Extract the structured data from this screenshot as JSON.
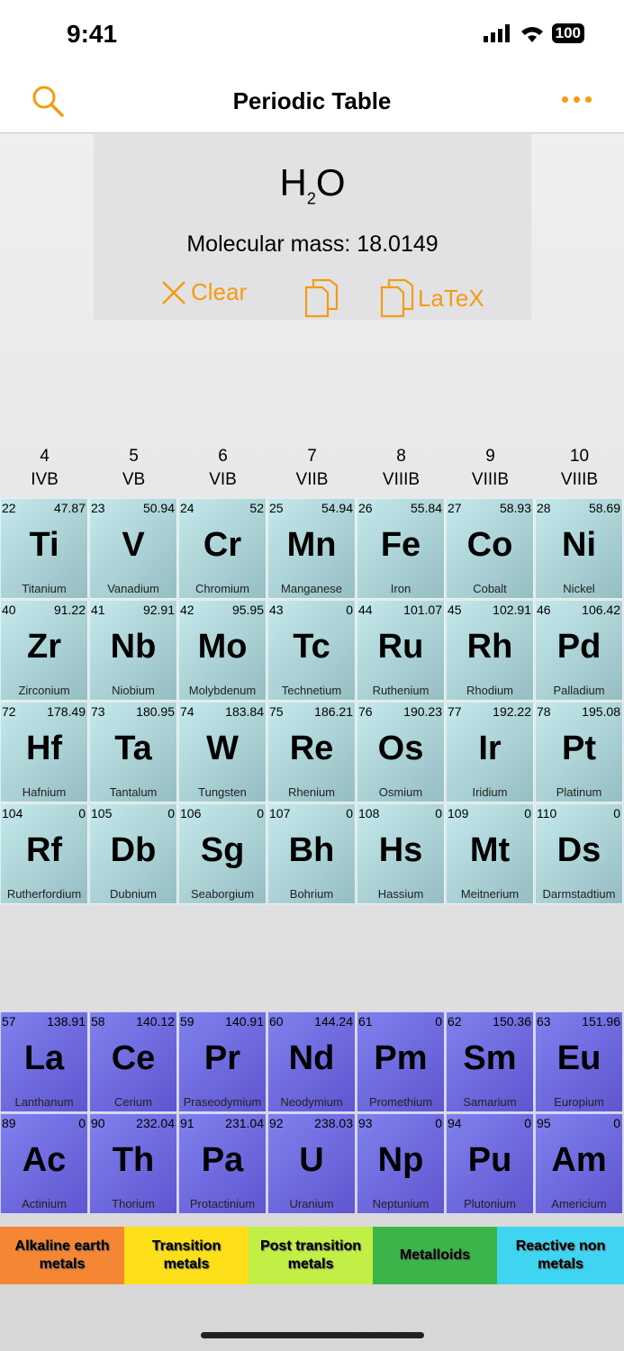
{
  "status": {
    "time": "9:41",
    "battery": "100"
  },
  "nav": {
    "title": "Periodic Table"
  },
  "formula": {
    "main": "H",
    "sub": "2",
    "tail": "O",
    "mass": "Molecular mass: 18.0149",
    "clear": "Clear",
    "latex": "LaTeX"
  },
  "groups": [
    {
      "n": "4",
      "r": "IVB"
    },
    {
      "n": "5",
      "r": "VB"
    },
    {
      "n": "6",
      "r": "VIB"
    },
    {
      "n": "7",
      "r": "VIIB"
    },
    {
      "n": "8",
      "r": "VIIIB"
    },
    {
      "n": "9",
      "r": "VIIIB"
    },
    {
      "n": "10",
      "r": "VIIIB"
    }
  ],
  "transition": [
    [
      {
        "n": "22",
        "m": "47.87",
        "s": "Ti",
        "name": "Titanium"
      },
      {
        "n": "23",
        "m": "50.94",
        "s": "V",
        "name": "Vanadium"
      },
      {
        "n": "24",
        "m": "52",
        "s": "Cr",
        "name": "Chromium"
      },
      {
        "n": "25",
        "m": "54.94",
        "s": "Mn",
        "name": "Manganese"
      },
      {
        "n": "26",
        "m": "55.84",
        "s": "Fe",
        "name": "Iron"
      },
      {
        "n": "27",
        "m": "58.93",
        "s": "Co",
        "name": "Cobalt"
      },
      {
        "n": "28",
        "m": "58.69",
        "s": "Ni",
        "name": "Nickel"
      }
    ],
    [
      {
        "n": "40",
        "m": "91.22",
        "s": "Zr",
        "name": "Zirconium"
      },
      {
        "n": "41",
        "m": "92.91",
        "s": "Nb",
        "name": "Niobium"
      },
      {
        "n": "42",
        "m": "95.95",
        "s": "Mo",
        "name": "Molybdenum"
      },
      {
        "n": "43",
        "m": "0",
        "s": "Tc",
        "name": "Technetium"
      },
      {
        "n": "44",
        "m": "101.07",
        "s": "Ru",
        "name": "Ruthenium"
      },
      {
        "n": "45",
        "m": "102.91",
        "s": "Rh",
        "name": "Rhodium"
      },
      {
        "n": "46",
        "m": "106.42",
        "s": "Pd",
        "name": "Palladium"
      }
    ],
    [
      {
        "n": "72",
        "m": "178.49",
        "s": "Hf",
        "name": "Hafnium"
      },
      {
        "n": "73",
        "m": "180.95",
        "s": "Ta",
        "name": "Tantalum"
      },
      {
        "n": "74",
        "m": "183.84",
        "s": "W",
        "name": "Tungsten"
      },
      {
        "n": "75",
        "m": "186.21",
        "s": "Re",
        "name": "Rhenium"
      },
      {
        "n": "76",
        "m": "190.23",
        "s": "Os",
        "name": "Osmium"
      },
      {
        "n": "77",
        "m": "192.22",
        "s": "Ir",
        "name": "Iridium"
      },
      {
        "n": "78",
        "m": "195.08",
        "s": "Pt",
        "name": "Platinum"
      }
    ],
    [
      {
        "n": "104",
        "m": "0",
        "s": "Rf",
        "name": "Rutherfordium"
      },
      {
        "n": "105",
        "m": "0",
        "s": "Db",
        "name": "Dubnium"
      },
      {
        "n": "106",
        "m": "0",
        "s": "Sg",
        "name": "Seaborgium"
      },
      {
        "n": "107",
        "m": "0",
        "s": "Bh",
        "name": "Bohrium"
      },
      {
        "n": "108",
        "m": "0",
        "s": "Hs",
        "name": "Hassium"
      },
      {
        "n": "109",
        "m": "0",
        "s": "Mt",
        "name": "Meitnerium"
      },
      {
        "n": "110",
        "m": "0",
        "s": "Ds",
        "name": "Darmstadtium"
      }
    ]
  ],
  "fblock": [
    [
      {
        "n": "57",
        "m": "138.91",
        "s": "La",
        "name": "Lanthanum"
      },
      {
        "n": "58",
        "m": "140.12",
        "s": "Ce",
        "name": "Cerium"
      },
      {
        "n": "59",
        "m": "140.91",
        "s": "Pr",
        "name": "Praseodymium"
      },
      {
        "n": "60",
        "m": "144.24",
        "s": "Nd",
        "name": "Neodymium"
      },
      {
        "n": "61",
        "m": "0",
        "s": "Pm",
        "name": "Promethium"
      },
      {
        "n": "62",
        "m": "150.36",
        "s": "Sm",
        "name": "Samarium"
      },
      {
        "n": "63",
        "m": "151.96",
        "s": "Eu",
        "name": "Europium"
      }
    ],
    [
      {
        "n": "89",
        "m": "0",
        "s": "Ac",
        "name": "Actinium"
      },
      {
        "n": "90",
        "m": "232.04",
        "s": "Th",
        "name": "Thorium"
      },
      {
        "n": "91",
        "m": "231.04",
        "s": "Pa",
        "name": "Protactinium"
      },
      {
        "n": "92",
        "m": "238.03",
        "s": "U",
        "name": "Uranium"
      },
      {
        "n": "93",
        "m": "0",
        "s": "Np",
        "name": "Neptunium"
      },
      {
        "n": "94",
        "m": "0",
        "s": "Pu",
        "name": "Plutonium"
      },
      {
        "n": "95",
        "m": "0",
        "s": "Am",
        "name": "Americium"
      }
    ]
  ],
  "legend": [
    {
      "label": "Alkaline earth metals",
      "color": "#f58634"
    },
    {
      "label": "Transition metals",
      "color": "#fde01a"
    },
    {
      "label": "Post transition metals",
      "color": "#c2ef46"
    },
    {
      "label": "Metalloids",
      "color": "#3bb54a"
    },
    {
      "label": "Reactive non metals",
      "color": "#3fd4f1"
    }
  ]
}
